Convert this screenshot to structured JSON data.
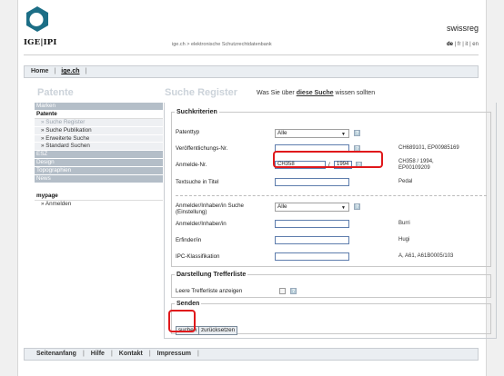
{
  "header": {
    "logo_text": "IGE|IPI",
    "brand": "swissreg",
    "breadcrumb": "ige.ch > elektronische Schutzrechtdatenbank",
    "lang_current": "de",
    "lang_others": " | fr | it | en"
  },
  "nav": {
    "home": "Home",
    "sep": "|",
    "ige": "ige.ch",
    "sep2": "|"
  },
  "section_title": "Patente",
  "page": {
    "heading": "Suche Register",
    "sub_pre": "Was Sie über ",
    "sub_link": "diese Suche",
    "sub_post": " wissen sollten"
  },
  "sidebar": {
    "items": [
      {
        "label": "Marken"
      },
      {
        "label": "Patente"
      },
      {
        "label": "» Suche Register"
      },
      {
        "label": "» Suche Publikation"
      },
      {
        "label": "» Erweiterte Suche"
      },
      {
        "label": "» Standard Suchen"
      },
      {
        "label": "ESZ"
      },
      {
        "label": "Design"
      },
      {
        "label": "Topographien"
      },
      {
        "label": "News"
      },
      {
        "label": "mypage"
      },
      {
        "label": "» Anmelden"
      }
    ]
  },
  "criteria": {
    "legend": "Suchkriterien",
    "patenttyp_label": "Patenttyp",
    "patenttyp_value": "Alle",
    "veroeff_label": "Veröffentlichungs-Nr.",
    "veroeff_example": "CH689101, EP00985169",
    "anmelde_label": "Anmelde-Nr.",
    "anmelde_value1": "CH358",
    "anmelde_sep": "/",
    "anmelde_value2": "1994",
    "anmelde_example1": "CH358 / 1994,",
    "anmelde_example2": "EP00109209",
    "textsuche_label": "Textsuche in Titel",
    "textsuche_example": "Pedal",
    "inhaber_suche_label1": "Anmelder/Inhaber/in Suche",
    "inhaber_suche_label2": "(Einstellung)",
    "inhaber_suche_value": "Alle",
    "inhaber_label": "Anmelder/Inhaber/in",
    "inhaber_example": "Burri",
    "erfinder_label": "Erfinder/in",
    "erfinder_example": "Hugi",
    "ipc_label": "IPC-Klassifikation",
    "ipc_example": "A, A61, A61B0005/103",
    "help": "?"
  },
  "darstellung": {
    "legend": "Darstellung Trefferliste",
    "leere_label": "Leere Trefferliste anzeigen"
  },
  "senden": {
    "legend": "Senden",
    "suchen": "suchen",
    "reset": "zurücksetzen"
  },
  "footer": {
    "items": [
      "Seitenanfang",
      "Hilfe",
      "Kontakt",
      "Impressum"
    ],
    "sep": "|"
  },
  "colors": {
    "highlight": "#e0181b",
    "logo": "#1c6e86",
    "nav_bg": "#eaeef2"
  },
  "icons": [
    "logo-mark-icon",
    "chevron-down-icon",
    "help-icon",
    "checkbox-icon"
  ]
}
